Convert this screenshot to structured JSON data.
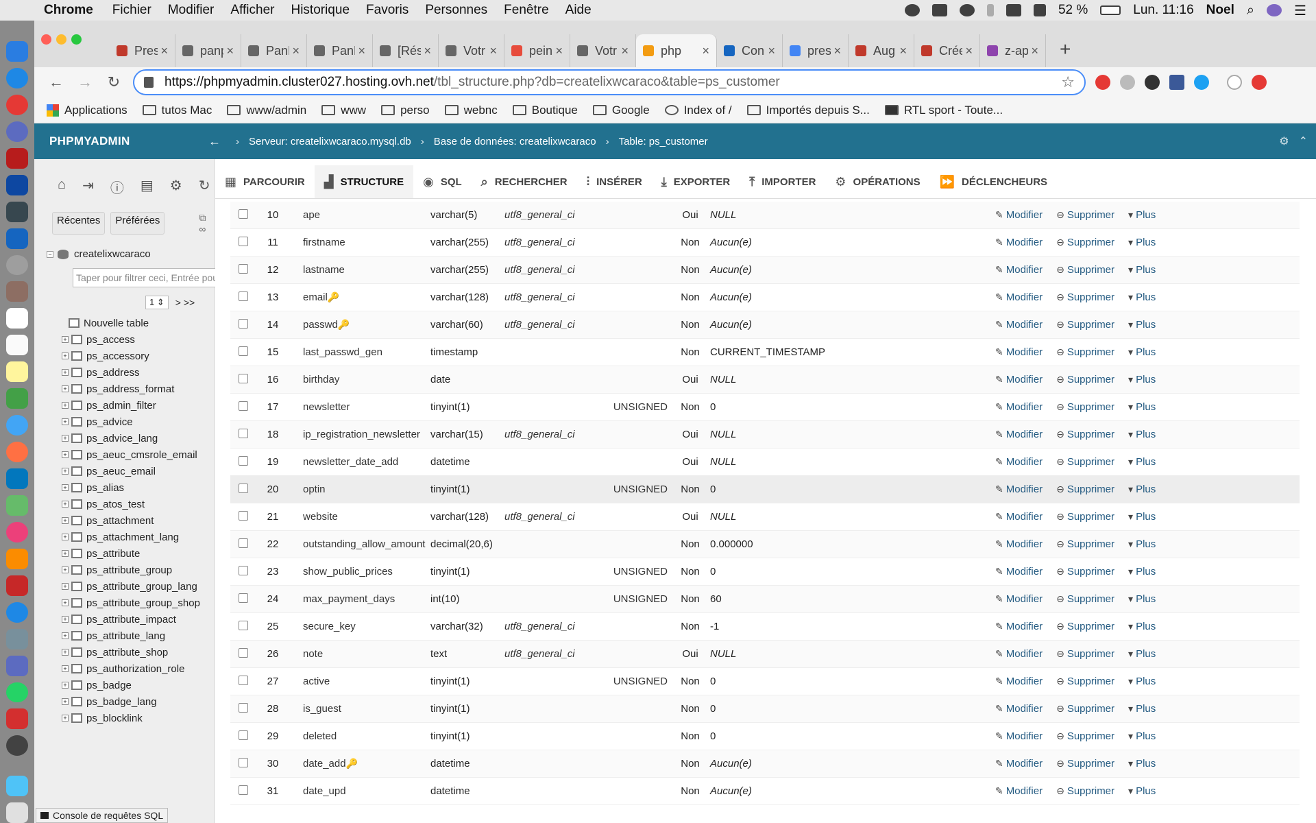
{
  "menubar": {
    "app": "Chrome",
    "items": [
      "Fichier",
      "Modifier",
      "Afficher",
      "Historique",
      "Favoris",
      "Personnes",
      "Fenêtre",
      "Aide"
    ],
    "battery": "52 %",
    "clock": "Lun. 11:16",
    "user": "Noel"
  },
  "tabs": [
    {
      "label": "Pres",
      "icon": "chrome-icon",
      "color": "#c0392b"
    },
    {
      "label": "panp",
      "icon": "doc-icon",
      "color": "#666"
    },
    {
      "label": "PanP",
      "icon": "doc-icon",
      "color": "#666"
    },
    {
      "label": "PanP",
      "icon": "doc-icon",
      "color": "#666"
    },
    {
      "label": "[Rés",
      "icon": "doc-icon",
      "color": "#666"
    },
    {
      "label": "Votr",
      "icon": "doc-icon",
      "color": "#666"
    },
    {
      "label": "pein",
      "icon": "paint-icon",
      "color": "#e74c3c"
    },
    {
      "label": "Votr",
      "icon": "doc-icon",
      "color": "#666"
    },
    {
      "label": "php",
      "icon": "pma-icon",
      "color": "#f39c12",
      "active": true
    },
    {
      "label": "Con",
      "icon": "paypal-icon",
      "color": "#1565c0"
    },
    {
      "label": "pres",
      "icon": "google-icon",
      "color": "#4285f4"
    },
    {
      "label": "Aug",
      "icon": "chrome-icon",
      "color": "#c0392b"
    },
    {
      "label": "Crée",
      "icon": "chrome-icon",
      "color": "#c0392b"
    },
    {
      "label": "z-ap",
      "icon": "image-icon",
      "color": "#8e44ad"
    }
  ],
  "url": {
    "host": "https://phpmyadmin.cluster027.hosting.ovh.net",
    "path": "/tbl_structure.php?db=createlixwcaraco&table=ps_customer"
  },
  "bookmarks": [
    "Applications",
    "tutos Mac",
    "www/admin",
    "www",
    "perso",
    "webnc",
    "Boutique",
    "Google",
    "Index of /",
    "Importés depuis S...",
    "RTL sport - Toute..."
  ],
  "pma": {
    "logo": "PHPMYADMIN",
    "breadcrumb": {
      "server": "Serveur: createlixwcaraco.mysql.db",
      "database": "Base de données: createlixwcaraco",
      "table": "Table: ps_customer"
    },
    "left": {
      "tab_recent": "Récentes",
      "tab_favorites": "Préférées",
      "db": "createlixwcaraco",
      "filter_placeholder": "Taper pour filtrer ceci, Entrée pour t",
      "page": "1",
      "page_next": "> >>",
      "new_table": "Nouvelle table",
      "tables": [
        "ps_access",
        "ps_accessory",
        "ps_address",
        "ps_address_format",
        "ps_admin_filter",
        "ps_advice",
        "ps_advice_lang",
        "ps_aeuc_cmsrole_email",
        "ps_aeuc_email",
        "ps_alias",
        "ps_atos_test",
        "ps_attachment",
        "ps_attachment_lang",
        "ps_attribute",
        "ps_attribute_group",
        "ps_attribute_group_lang",
        "ps_attribute_group_shop",
        "ps_attribute_impact",
        "ps_attribute_lang",
        "ps_attribute_shop",
        "ps_authorization_role",
        "ps_badge",
        "ps_badge_lang",
        "ps_blocklink"
      ]
    },
    "tabs": [
      "Parcourir",
      "Structure",
      "SQL",
      "Rechercher",
      "Insérer",
      "Exporter",
      "Importer",
      "Opérations",
      "Déclencheurs"
    ],
    "actions": {
      "edit": "Modifier",
      "delete": "Supprimer",
      "more": "Plus"
    },
    "console": "Console de requêtes SQL",
    "columns": [
      {
        "n": "10",
        "name": "ape",
        "type": "varchar(5)",
        "coll": "utf8_general_ci",
        "attr": "",
        "null": "Oui",
        "def": "NULL",
        "defit": true
      },
      {
        "n": "11",
        "name": "firstname",
        "type": "varchar(255)",
        "coll": "utf8_general_ci",
        "attr": "",
        "null": "Non",
        "def": "Aucun(e)",
        "defit": true
      },
      {
        "n": "12",
        "name": "lastname",
        "type": "varchar(255)",
        "coll": "utf8_general_ci",
        "attr": "",
        "null": "Non",
        "def": "Aucun(e)",
        "defit": true
      },
      {
        "n": "13",
        "name": "email",
        "key": true,
        "type": "varchar(128)",
        "coll": "utf8_general_ci",
        "attr": "",
        "null": "Non",
        "def": "Aucun(e)",
        "defit": true
      },
      {
        "n": "14",
        "name": "passwd",
        "key": true,
        "type": "varchar(60)",
        "coll": "utf8_general_ci",
        "attr": "",
        "null": "Non",
        "def": "Aucun(e)",
        "defit": true
      },
      {
        "n": "15",
        "name": "last_passwd_gen",
        "type": "timestamp",
        "coll": "",
        "attr": "",
        "null": "Non",
        "def": "CURRENT_TIMESTAMP",
        "defit": false
      },
      {
        "n": "16",
        "name": "birthday",
        "type": "date",
        "coll": "",
        "attr": "",
        "null": "Oui",
        "def": "NULL",
        "defit": true
      },
      {
        "n": "17",
        "name": "newsletter",
        "type": "tinyint(1)",
        "coll": "",
        "attr": "UNSIGNED",
        "null": "Non",
        "def": "0",
        "defit": false
      },
      {
        "n": "18",
        "name": "ip_registration_newsletter",
        "type": "varchar(15)",
        "coll": "utf8_general_ci",
        "attr": "",
        "null": "Oui",
        "def": "NULL",
        "defit": true
      },
      {
        "n": "19",
        "name": "newsletter_date_add",
        "type": "datetime",
        "coll": "",
        "attr": "",
        "null": "Oui",
        "def": "NULL",
        "defit": true
      },
      {
        "n": "20",
        "name": "optin",
        "type": "tinyint(1)",
        "coll": "",
        "attr": "UNSIGNED",
        "null": "Non",
        "def": "0",
        "defit": false,
        "hl": true
      },
      {
        "n": "21",
        "name": "website",
        "type": "varchar(128)",
        "coll": "utf8_general_ci",
        "attr": "",
        "null": "Oui",
        "def": "NULL",
        "defit": true
      },
      {
        "n": "22",
        "name": "outstanding_allow_amount",
        "type": "decimal(20,6)",
        "coll": "",
        "attr": "",
        "null": "Non",
        "def": "0.000000",
        "defit": false
      },
      {
        "n": "23",
        "name": "show_public_prices",
        "type": "tinyint(1)",
        "coll": "",
        "attr": "UNSIGNED",
        "null": "Non",
        "def": "0",
        "defit": false
      },
      {
        "n": "24",
        "name": "max_payment_days",
        "type": "int(10)",
        "coll": "",
        "attr": "UNSIGNED",
        "null": "Non",
        "def": "60",
        "defit": false
      },
      {
        "n": "25",
        "name": "secure_key",
        "type": "varchar(32)",
        "coll": "utf8_general_ci",
        "attr": "",
        "null": "Non",
        "def": "-1",
        "defit": false
      },
      {
        "n": "26",
        "name": "note",
        "type": "text",
        "coll": "utf8_general_ci",
        "attr": "",
        "null": "Oui",
        "def": "NULL",
        "defit": true
      },
      {
        "n": "27",
        "name": "active",
        "type": "tinyint(1)",
        "coll": "",
        "attr": "UNSIGNED",
        "null": "Non",
        "def": "0",
        "defit": false
      },
      {
        "n": "28",
        "name": "is_guest",
        "type": "tinyint(1)",
        "coll": "",
        "attr": "",
        "null": "Non",
        "def": "0",
        "defit": false
      },
      {
        "n": "29",
        "name": "deleted",
        "type": "tinyint(1)",
        "coll": "",
        "attr": "",
        "null": "Non",
        "def": "0",
        "defit": false
      },
      {
        "n": "30",
        "name": "date_add",
        "key": true,
        "type": "datetime",
        "coll": "",
        "attr": "",
        "null": "Non",
        "def": "Aucun(e)",
        "defit": true
      },
      {
        "n": "31",
        "name": "date_upd",
        "type": "datetime",
        "coll": "",
        "attr": "",
        "null": "Non",
        "def": "Aucun(e)",
        "defit": true
      }
    ]
  }
}
